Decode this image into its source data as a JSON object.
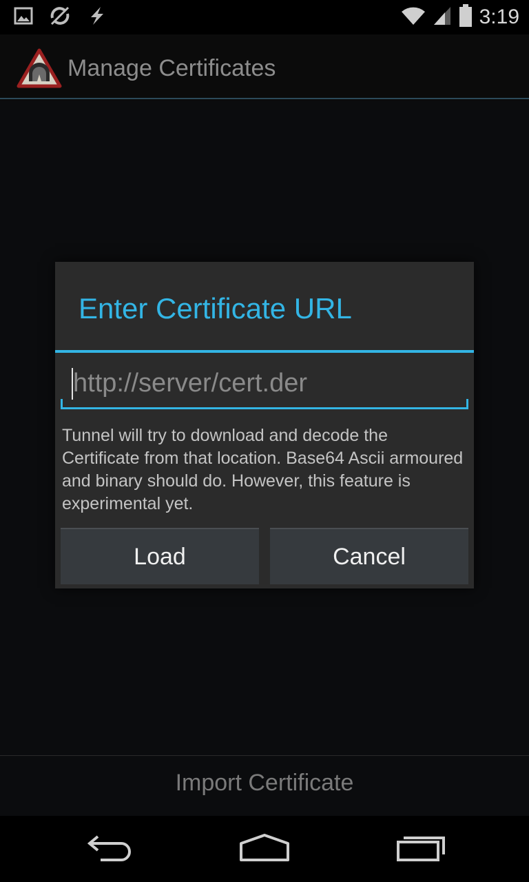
{
  "status_bar": {
    "time": "3:19",
    "icons": [
      "image-icon",
      "sync-off-icon",
      "flash-icon",
      "wifi-icon",
      "signal-icon",
      "battery-icon"
    ]
  },
  "action_bar": {
    "title": "Manage Certificates",
    "icon": "tunnel-warning-icon"
  },
  "dialog": {
    "title": "Enter Certificate URL",
    "url_input": {
      "value": "",
      "placeholder": "http://server/cert.der"
    },
    "message": "Tunnel will try to download and decode the Certificate from that location. Base64 Ascii armoured and binary should do. However, this feature is experimental yet.",
    "buttons": {
      "load": "Load",
      "cancel": "Cancel"
    }
  },
  "bottom": {
    "import_label": "Import Certificate"
  },
  "nav_bar": {
    "icons": [
      "back-icon",
      "home-icon",
      "recents-icon"
    ]
  },
  "colors": {
    "accent": "#33b5e5",
    "dialog_bg": "#2b2b2b",
    "background": "#0b0c0e"
  }
}
